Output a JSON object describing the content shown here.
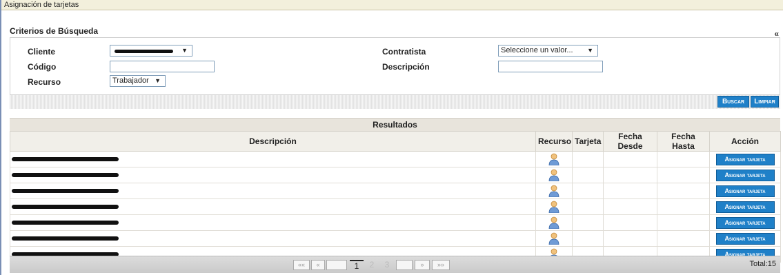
{
  "window": {
    "title": "Asignación de tarjetas"
  },
  "criteria": {
    "heading": "Criterios de Búsqueda",
    "collapse_glyph": "«",
    "cliente": {
      "label": "Cliente",
      "value": ""
    },
    "codigo": {
      "label": "Código",
      "value": ""
    },
    "recurso": {
      "label": "Recurso",
      "value": "Trabajador"
    },
    "contratista": {
      "label": "Contratista",
      "value": "Seleccione un valor..."
    },
    "descripcion": {
      "label": "Descripción",
      "value": ""
    },
    "dropdown_arrow": "▼",
    "buttons": {
      "search": "Buscar",
      "clear": "Limpiar"
    }
  },
  "results": {
    "heading": "Resultados",
    "columns": [
      "Descripción",
      "Recurso",
      "Tarjeta",
      "Fecha Desde",
      "Fecha Hasta",
      "Acción"
    ],
    "action_label": "Asignar tarjeta",
    "resource_icon": "person-icon",
    "row_count": 7
  },
  "pager": {
    "first": "««",
    "prev": "«",
    "pages": [
      "1",
      "2",
      "3"
    ],
    "current": "1",
    "next": "»",
    "last": "»»",
    "total": "Total:15"
  },
  "colors": {
    "button": "#1f80c8",
    "titlebar": "#f3f0dc",
    "header": "#e8e4dc"
  }
}
